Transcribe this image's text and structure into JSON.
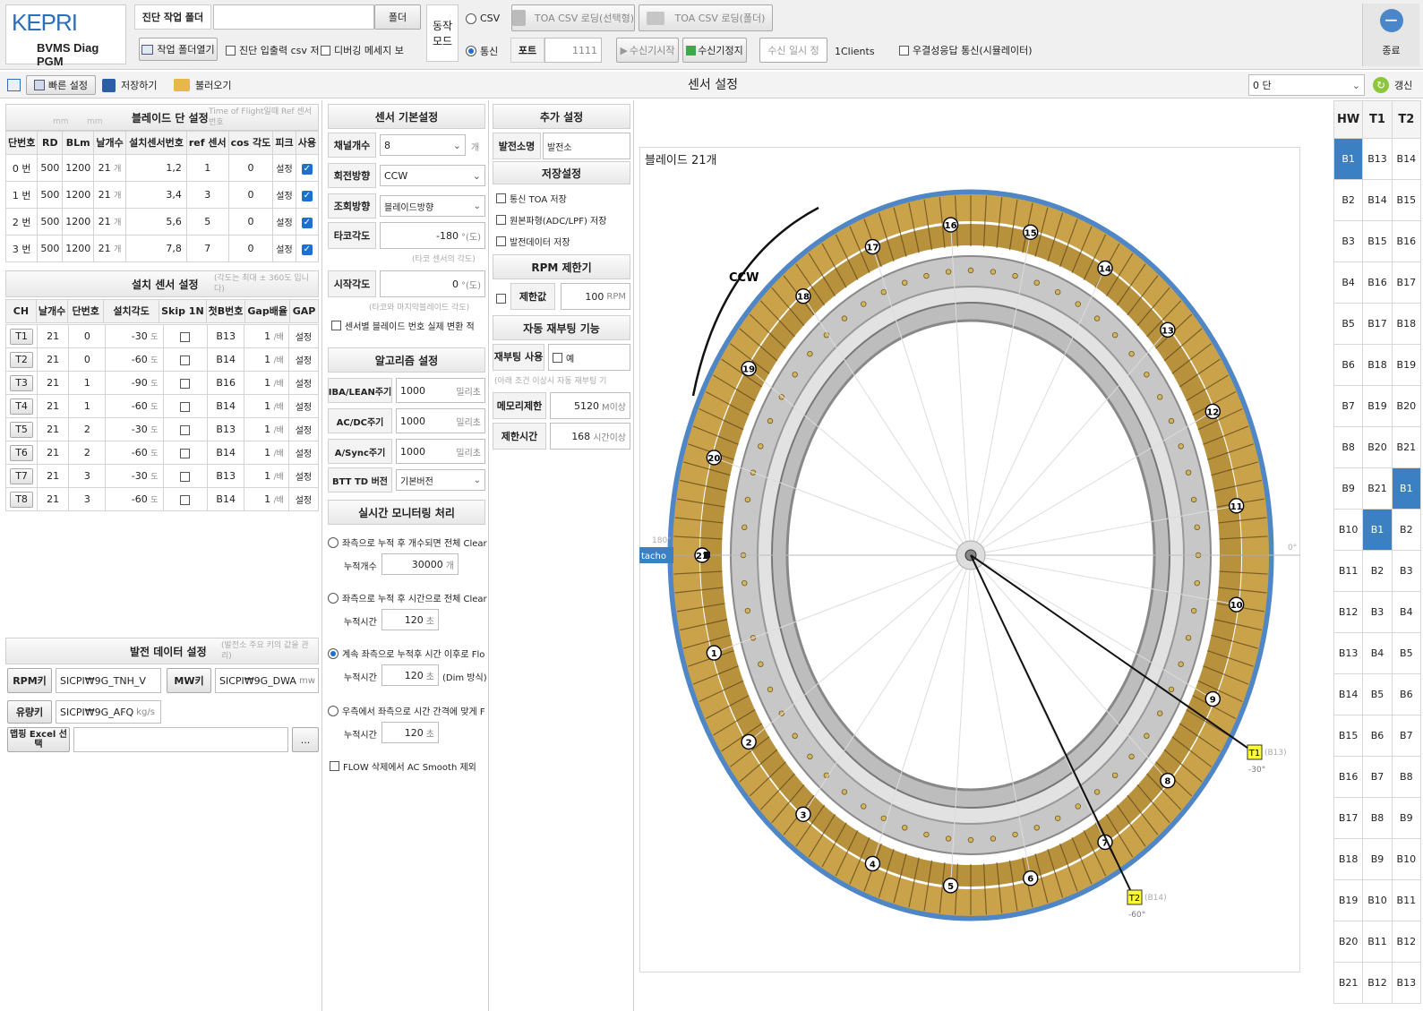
{
  "app": {
    "brand": "KEPRI",
    "subtitle": "BVMS Diag PGM"
  },
  "top": {
    "work_folder_label": "진단 작업 폴더",
    "work_folder_value": "",
    "folder_btn": "폴더",
    "open_folder_btn": "작업 폴더열기",
    "diag_csv_label": "진단 입출력 csv 저",
    "debug_msg_label": "디버깅 메세지 보",
    "mode_label": "동작 모드",
    "csv_label": "CSV",
    "comm_label": "통신",
    "toa_csv_select": "TOA CSV 로딩(선택형)",
    "toa_csv_folder": "TOA CSV 로딩(폴더)",
    "port_label": "포트",
    "port_value": "1111",
    "start_recv": "수신기시작",
    "stop_recv": "수신기정지",
    "pause_recv": "수신 일시 정",
    "clients": "1Clients",
    "simulator_label": "우결성응답 통신(시뮬레이터)",
    "exit_label": "종료"
  },
  "toolbar": {
    "quick_setup": "빠른 설정",
    "save": "저장하기",
    "load": "불러오기",
    "title": "센서 설정",
    "stage_select": "0 단",
    "refresh": "갱신"
  },
  "blade_stage": {
    "title": "블레이드 단 설정",
    "hint": "Time of Flight일때 Ref 센서 번호",
    "unit_mm1": "mm",
    "unit_mm2": "mm",
    "headers": [
      "단번호",
      "RD",
      "BLm",
      "날개수",
      "설치센서번호",
      "ref 센서",
      "cos 각도",
      "피크",
      "사용"
    ],
    "rows": [
      {
        "stage": "0 번",
        "rd": "500",
        "blm": "1200",
        "blades": "21",
        "sensors": "1,2",
        "ref": "1",
        "cos": "0",
        "peak": "설정"
      },
      {
        "stage": "1 번",
        "rd": "500",
        "blm": "1200",
        "blades": "21",
        "sensors": "3,4",
        "ref": "3",
        "cos": "0",
        "peak": "설정"
      },
      {
        "stage": "2 번",
        "rd": "500",
        "blm": "1200",
        "blades": "21",
        "sensors": "5,6",
        "ref": "5",
        "cos": "0",
        "peak": "설정"
      },
      {
        "stage": "3 번",
        "rd": "500",
        "blm": "1200",
        "blades": "21",
        "sensors": "7,8",
        "ref": "7",
        "cos": "0",
        "peak": "설정"
      }
    ],
    "blade_unit": "개"
  },
  "sensor_install": {
    "title": "설치 센서 설정",
    "hint": "(각도는 최대 ± 360도 입니다)",
    "headers": [
      "CH",
      "날개수",
      "단번호",
      "설치각도",
      "Skip 1N",
      "첫B번호",
      "Gap배율",
      "GAP"
    ],
    "unit_deg": "도",
    "unit_mult": "/배",
    "rows": [
      {
        "ch": "T1",
        "blades": "21",
        "stage": "0",
        "angle": "-30",
        "first": "B13",
        "gap": "1",
        "btn": "설정"
      },
      {
        "ch": "T2",
        "blades": "21",
        "stage": "0",
        "angle": "-60",
        "first": "B14",
        "gap": "1",
        "btn": "설정"
      },
      {
        "ch": "T3",
        "blades": "21",
        "stage": "1",
        "angle": "-90",
        "first": "B16",
        "gap": "1",
        "btn": "설정"
      },
      {
        "ch": "T4",
        "blades": "21",
        "stage": "1",
        "angle": "-60",
        "first": "B14",
        "gap": "1",
        "btn": "설정"
      },
      {
        "ch": "T5",
        "blades": "21",
        "stage": "2",
        "angle": "-30",
        "first": "B13",
        "gap": "1",
        "btn": "설정"
      },
      {
        "ch": "T6",
        "blades": "21",
        "stage": "2",
        "angle": "-60",
        "first": "B14",
        "gap": "1",
        "btn": "설정"
      },
      {
        "ch": "T7",
        "blades": "21",
        "stage": "3",
        "angle": "-30",
        "first": "B13",
        "gap": "1",
        "btn": "설정"
      },
      {
        "ch": "T8",
        "blades": "21",
        "stage": "3",
        "angle": "-60",
        "first": "B14",
        "gap": "1",
        "btn": "설정"
      }
    ]
  },
  "plant_data": {
    "title": "발전 데이터 설정",
    "hint": "(발전소 주요 키의 값을 관리)",
    "rpm_label": "RPM키",
    "rpm_value": "SICPI₩9G_TNH_V",
    "mw_label": "MW키",
    "mw_value": "SICPI₩9G_DWA",
    "mw_unit": "mw",
    "flow_label": "유량키",
    "flow_value": "SICPI₩9G_AFQ",
    "flow_unit": "kg/s",
    "excel_label": "맵핑 Excel 선택",
    "excel_value": "",
    "browse": "..."
  },
  "sensor_basic": {
    "title": "센서 기본설정",
    "channels_label": "채널개수",
    "channels_value": "8",
    "channels_unit": "개",
    "rotation_label": "회전방향",
    "rotation_value": "CCW",
    "view_label": "조회방향",
    "view_value": "블레이드방향",
    "tacho_label": "타코각도",
    "tacho_value": "-180",
    "tacho_unit": "°(도)",
    "tacho_hint": "(타코 센서의 각도)",
    "start_label": "시작각도",
    "start_value": "0",
    "start_unit": "°(도)",
    "start_hint": "(타코와 마지막블레이드 각도)",
    "realnum_label": "센서별 블레이드 번호 실제 변환 적"
  },
  "algorithm": {
    "title": "알고리즘 설정",
    "ibalean_label": "IBA/LEAN주기",
    "ibalean_value": "1000",
    "acdc_label": "AC/DC주기",
    "acdc_value": "1000",
    "async_label": "A/Sync주기",
    "async_value": "1000",
    "ms_unit": "밀리초",
    "bttd_label": "BTT TD 버전",
    "bttd_value": "기본버전"
  },
  "realtime": {
    "title": "실시간 모니터링 처리",
    "opt1": "좌측으로 누적 후 개수되면 전체 Clear",
    "opt1_sub": "누적개수",
    "opt1_value": "30000",
    "opt1_unit": "개",
    "opt2": "좌측으로 누적 후 시간으로 전체 Clear",
    "opt2_sub": "누적시간",
    "opt2_value": "120",
    "sec_unit": "초",
    "opt3": "계속 좌측으로 누적후 시간 이후로 Flo",
    "opt3_sub": "누적시간",
    "opt3_value": "120",
    "opt3_extra": "(Dim 방식)",
    "opt4": "우측에서 좌측으로 시간 간격에 맞게 F",
    "opt4_sub": "누적시간",
    "opt4_value": "120",
    "flow_exclude": "FLOW 삭제에서 AC Smooth 제외"
  },
  "extra": {
    "title": "추가 설정",
    "plant_label": "발전소명",
    "plant_value": "발전소",
    "save_title": "저장설정",
    "save1": "통신 TOA 저장",
    "save2": "원본파형(ADC/LPF) 저장",
    "save3": "발전데이터 저장",
    "rpm_title": "RPM 제한기",
    "limit_label": "제한값",
    "limit_value": "100",
    "limit_unit": "RPM",
    "reboot_title": "자동 재부팅 기능",
    "reboot_label": "재부팅 사용",
    "reboot_yes": "예",
    "reboot_hint": "(아래 조건 이상시 자동 재부팅 기",
    "mem_label": "메모리제한",
    "mem_value": "5120",
    "mem_unit": "M이상",
    "time_label": "제한시간",
    "time_value": "168",
    "time_unit": "시간이상"
  },
  "diagram": {
    "title": "블레이드 21개",
    "blade_count": 21,
    "direction": "CCW",
    "tacho_label": "tacho",
    "left_angle": "180°",
    "right_angle": "0°",
    "sensors": [
      {
        "name": "T1",
        "blade": "(B13)",
        "angle": "-30°",
        "deg": -30
      },
      {
        "name": "T2",
        "blade": "(B14)",
        "angle": "-60°",
        "deg": -60
      }
    ]
  },
  "hw_table": {
    "headers": [
      "HW",
      "T1",
      "T2"
    ],
    "rows": [
      [
        "B1",
        "B13",
        "B14"
      ],
      [
        "B2",
        "B14",
        "B15"
      ],
      [
        "B3",
        "B15",
        "B16"
      ],
      [
        "B4",
        "B16",
        "B17"
      ],
      [
        "B5",
        "B17",
        "B18"
      ],
      [
        "B6",
        "B18",
        "B19"
      ],
      [
        "B7",
        "B19",
        "B20"
      ],
      [
        "B8",
        "B20",
        "B21"
      ],
      [
        "B9",
        "B21",
        "B1"
      ],
      [
        "B10",
        "B1",
        "B2"
      ],
      [
        "B11",
        "B2",
        "B3"
      ],
      [
        "B12",
        "B3",
        "B4"
      ],
      [
        "B13",
        "B4",
        "B5"
      ],
      [
        "B14",
        "B5",
        "B6"
      ],
      [
        "B15",
        "B6",
        "B7"
      ],
      [
        "B16",
        "B7",
        "B8"
      ],
      [
        "B17",
        "B8",
        "B9"
      ],
      [
        "B18",
        "B9",
        "B10"
      ],
      [
        "B19",
        "B10",
        "B11"
      ],
      [
        "B20",
        "B11",
        "B12"
      ],
      [
        "B21",
        "B12",
        "B13"
      ]
    ],
    "highlight": [
      [
        0,
        0
      ],
      [
        8,
        2
      ],
      [
        9,
        1
      ]
    ]
  },
  "colors": {
    "accent": "#3b80c2",
    "gold": "#c9a24a",
    "ring_blue": "#4f86c6"
  }
}
